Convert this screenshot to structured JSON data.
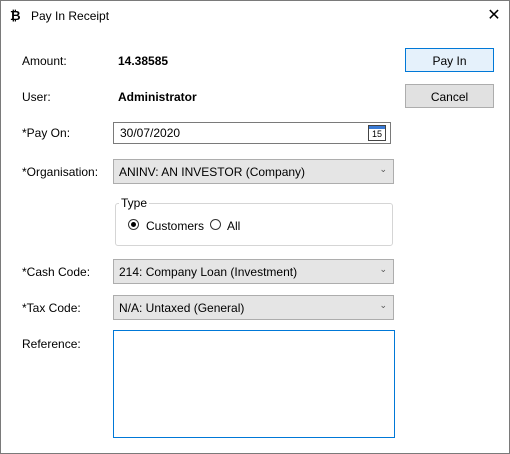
{
  "window": {
    "title": "Pay In Receipt",
    "app_icon": "₿",
    "close_glyph": "✕"
  },
  "fields": {
    "amount_label": "Amount:",
    "amount_value": "14.38585",
    "user_label": "User:",
    "user_value": "Administrator",
    "pay_on_label": "*Pay On:",
    "pay_on_value": "30/07/2020",
    "calendar_day": "15",
    "organisation_label": "*Organisation:",
    "organisation_value": "ANINV: AN INVESTOR (Company)",
    "type_title": "Type",
    "type_options": [
      "Customers",
      "All"
    ],
    "type_selected": "Customers",
    "cash_code_label": "*Cash Code:",
    "cash_code_value": "214: Company Loan (Investment)",
    "tax_code_label": "*Tax Code:",
    "tax_code_value": "N/A: Untaxed (General)",
    "reference_label": "Reference:",
    "reference_value": ""
  },
  "buttons": {
    "pay_in": "Pay In",
    "cancel": "Cancel"
  },
  "icons": {
    "chevron": "⌄"
  }
}
